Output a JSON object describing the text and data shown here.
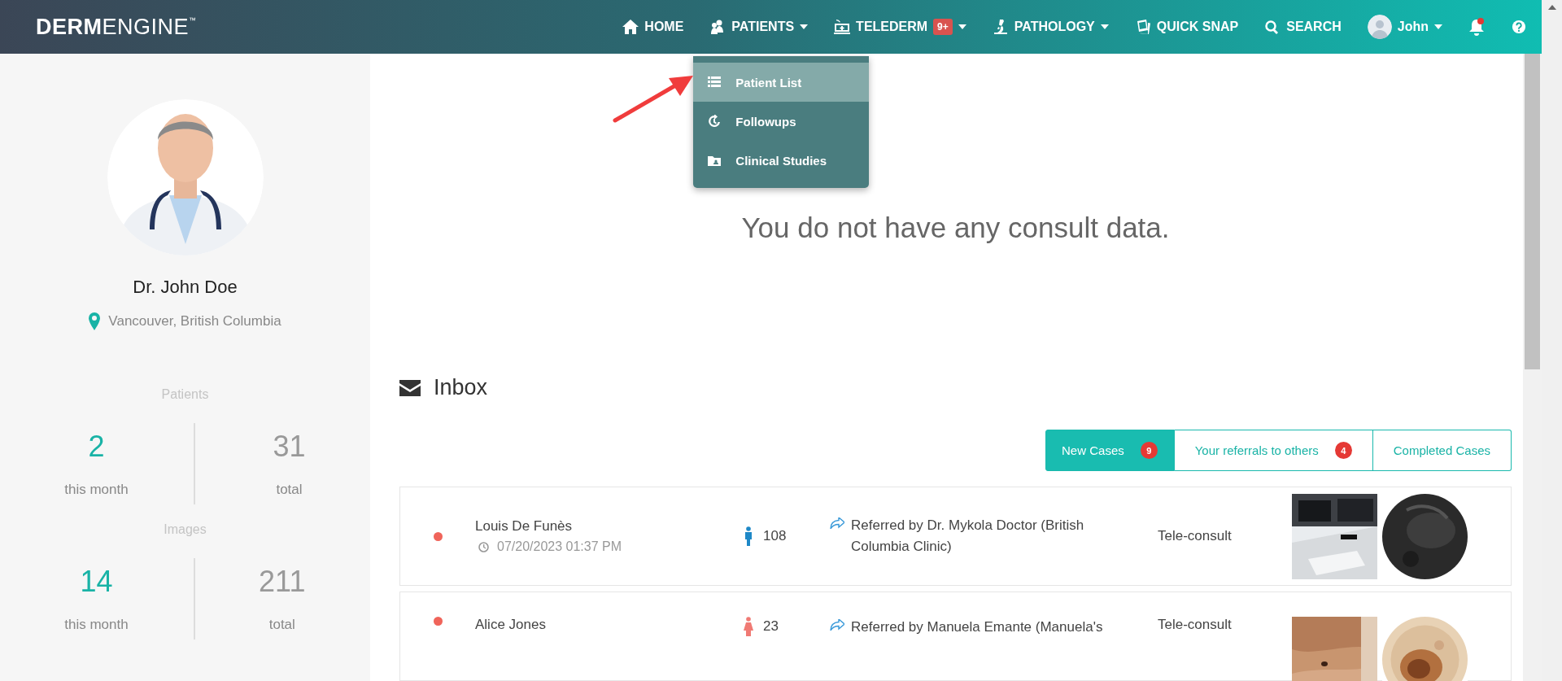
{
  "brand": {
    "bold": "DERM",
    "light": "ENGINE",
    "mark": "™"
  },
  "nav": [
    {
      "label": "HOME"
    },
    {
      "label": "PATIENTS",
      "dropdown": true,
      "menu": [
        {
          "label": "Patient List",
          "selected": true
        },
        {
          "label": "Followups",
          "selected": false
        },
        {
          "label": "Clinical Studies",
          "selected": false
        }
      ]
    },
    {
      "label": "TELEDERM",
      "dropdown": true,
      "badge": "9+"
    },
    {
      "label": "PATHOLOGY",
      "dropdown": true
    },
    {
      "label": "QUICK SNAP"
    },
    {
      "label": "SEARCH"
    }
  ],
  "user": {
    "name": "John",
    "dropdown": true
  },
  "notifications": {
    "unread": true
  },
  "profile": {
    "name": "Dr. John Doe",
    "location": "Vancouver, British Columbia"
  },
  "stats": [
    {
      "title": "Patients",
      "month": "2",
      "month_label": "this month",
      "total": "31",
      "total_label": "total"
    },
    {
      "title": "Images",
      "month": "14",
      "month_label": "this month",
      "total": "211",
      "total_label": "total"
    }
  ],
  "empty_message": "You do not have any consult data.",
  "inbox": {
    "title": "Inbox",
    "tabs": [
      {
        "label": "New Cases",
        "badge": "9",
        "selected": true
      },
      {
        "label": "Your referrals to others",
        "badge": "4",
        "selected": false
      },
      {
        "label": "Completed Cases",
        "selected": false
      }
    ],
    "rows": [
      {
        "name": "Louis De Funès",
        "date": "07/20/2023 01:37 PM",
        "female": false,
        "age": "108",
        "referral": "Referred by Dr. Mykola Doctor (British Columbia Clinic)",
        "type": "Tele-consult",
        "unread": true
      },
      {
        "name": "Alice Jones",
        "female": true,
        "age": "23",
        "referral": "Referred by Manuela Emante (Manuela's",
        "type": "Tele-consult",
        "unread": true
      }
    ]
  }
}
